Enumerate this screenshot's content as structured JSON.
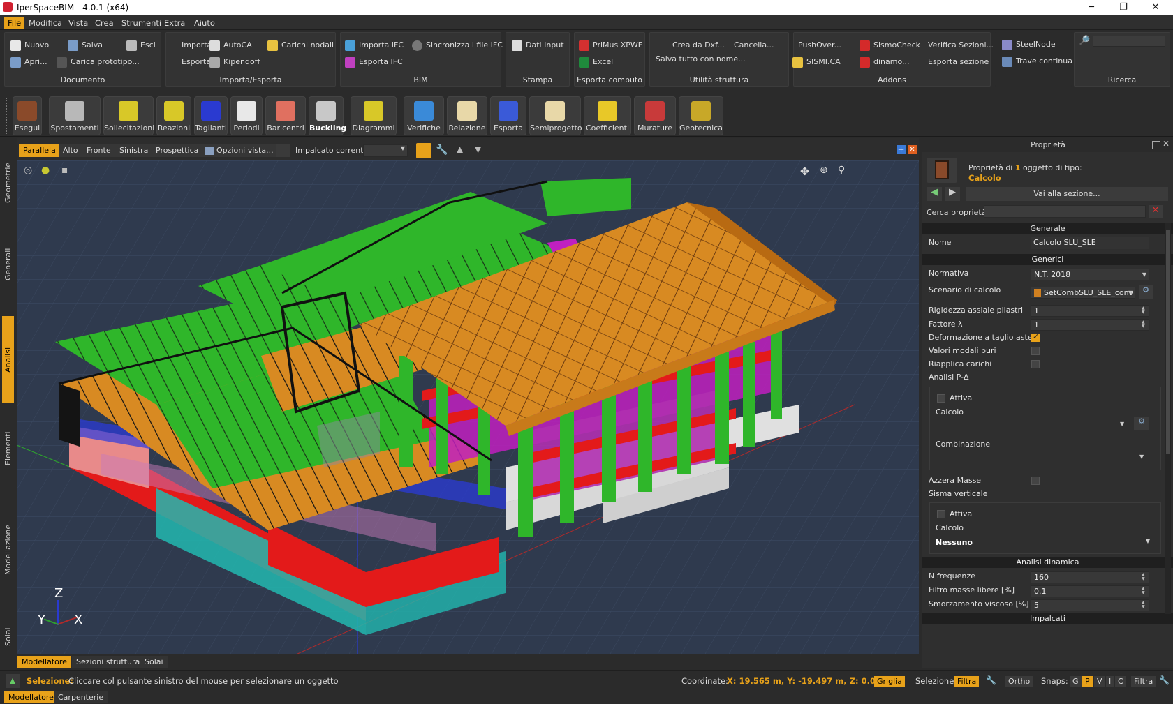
{
  "app": {
    "title": "IperSpaceBIM - 4.0.1 (x64)"
  },
  "window": {
    "minimize": "─",
    "restore": "❐",
    "close": "✕"
  },
  "menu": [
    "File",
    "Modifica",
    "Vista",
    "Crea",
    "Strumenti",
    "Extra",
    "Aiuto"
  ],
  "ribbon": {
    "documento": {
      "name": "Documento",
      "nuovo": "Nuovo",
      "salva": "Salva",
      "esci": "Esci",
      "apri": "Apri...",
      "carica": "Carica prototipo..."
    },
    "importa": {
      "name": "Importa/Esporta",
      "importa": "Importa",
      "autocad": "AutoCA",
      "carichi": "Carichi nodali",
      "esporta": "Esporta",
      "kipendoff": "Kipendoff"
    },
    "bim": {
      "name": "BIM",
      "importa_ifc": "Importa IFC",
      "sincronizza": "Sincronizza i file IFC",
      "esporta_ifc": "Esporta IFC"
    },
    "stampa": {
      "name": "Stampa",
      "dati": "Dati Input"
    },
    "computo": {
      "name": "Esporta computo",
      "primus": "PriMus XPWE",
      "excel": "Excel"
    },
    "utilita": {
      "name": "Utilità struttura",
      "crea": "Crea da Dxf...",
      "cancella": "Cancella...",
      "salva_nome": "Salva tutto con nome..."
    },
    "addons": {
      "name": "Addons",
      "pushover": "PushOver...",
      "sismocheck": "SismoCheck",
      "verifica": "Verifica Sezioni...",
      "sismica": "SISMI.CA",
      "dinamo": "dinamo...",
      "esporta_sez": "Esporta sezione",
      "steelnode": "SteelNode",
      "trave": "Trave continua"
    },
    "ricerca": {
      "name": "Ricerca"
    }
  },
  "tools": [
    "Esegui",
    "Spostamenti",
    "Sollecitazioni",
    "Reazioni",
    "Taglianti",
    "Periodi",
    "Baricentri",
    "Buckling",
    "Diagrammi",
    "Verifiche",
    "Relazione",
    "Esporta",
    "Semiprogetto",
    "Coefficienti",
    "Murature",
    "Geotecnica"
  ],
  "side_tabs": [
    "Geometrie",
    "Generali",
    "Analisi",
    "Elementi",
    "Modellazione",
    "Solai"
  ],
  "view": {
    "tabs": [
      "Parallela",
      "Alto",
      "Fronte",
      "Sinistra",
      "Prospettica"
    ],
    "opzioni": "Opzioni vista...",
    "impalcato": "Impalcato corrente:"
  },
  "axes": {
    "z": "Z",
    "y": "Y",
    "x": "X"
  },
  "bottom_tabs": [
    "Modellatore",
    "Sezioni strutturali",
    "Solai"
  ],
  "page_tabs": [
    "Modellatore",
    "Carpenterie"
  ],
  "props": {
    "title": "Proprietà",
    "desc_pre": "Proprietà di ",
    "count": "1",
    "desc_post": " oggetto di tipo:",
    "type": "Calcolo",
    "vai": "Vai alla sezione...",
    "cerca": "Cerca proprietà:",
    "generale": "Generale",
    "nome_l": "Nome",
    "nome_v": "Calcolo SLU_SLE",
    "generici": "Generici",
    "normativa_l": "Normativa",
    "normativa_v": "N.T. 2018",
    "scenario_l": "Scenario di calcolo",
    "scenario_v": "SetCombSLU_SLE_conv",
    "rigidezza_l": "Rigidezza assiale pilastri",
    "rigidezza_v": "1",
    "fattore_l": "Fattore λ",
    "fattore_v": "1",
    "deform_l": "Deformazione a taglio aste",
    "modali_l": "Valori modali puri",
    "riapplica_l": "Riapplica carichi",
    "pdelta_l": "Analisi P-Δ",
    "attiva": "Attiva",
    "calcolo": "Calcolo",
    "combinazione": "Combinazione",
    "azzera_l": "Azzera Masse",
    "sisma_l": "Sisma verticale",
    "nessuno": "Nessuno",
    "dinamica": "Analisi dinamica",
    "freq_l": "N frequenze",
    "freq_v": "160",
    "filtro_l": "Filtro masse libere [%]",
    "filtro_v": "0.1",
    "smorz_l": "Smorzamento viscoso [%]",
    "smorz_v": "5",
    "impalcati": "Impalcati"
  },
  "status": {
    "sel_label": "Selezione:",
    "sel_text": "Cliccare col pulsante sinistro del mouse per selezionare un oggetto",
    "coord_label": "Coordinate:",
    "coord_value": "X: 19.565 m, Y: -19.497 m, Z: 0.000 m",
    "griglia": "Griglia",
    "selezione": "Selezione:",
    "filtra": "Filtra",
    "ortho": "Ortho",
    "snaps": "Snaps:",
    "g": "G",
    "p": "P",
    "v": "V",
    "i": "I",
    "c": "C",
    "filtra2": "Filtra"
  },
  "colors": {
    "accent": "#e8a21a",
    "green": "#2fb62a",
    "orange": "#d88a22",
    "red": "#e31a1a",
    "magenta": "#c020c0",
    "teal": "#22b8b0",
    "blue": "#1a2ee0"
  }
}
